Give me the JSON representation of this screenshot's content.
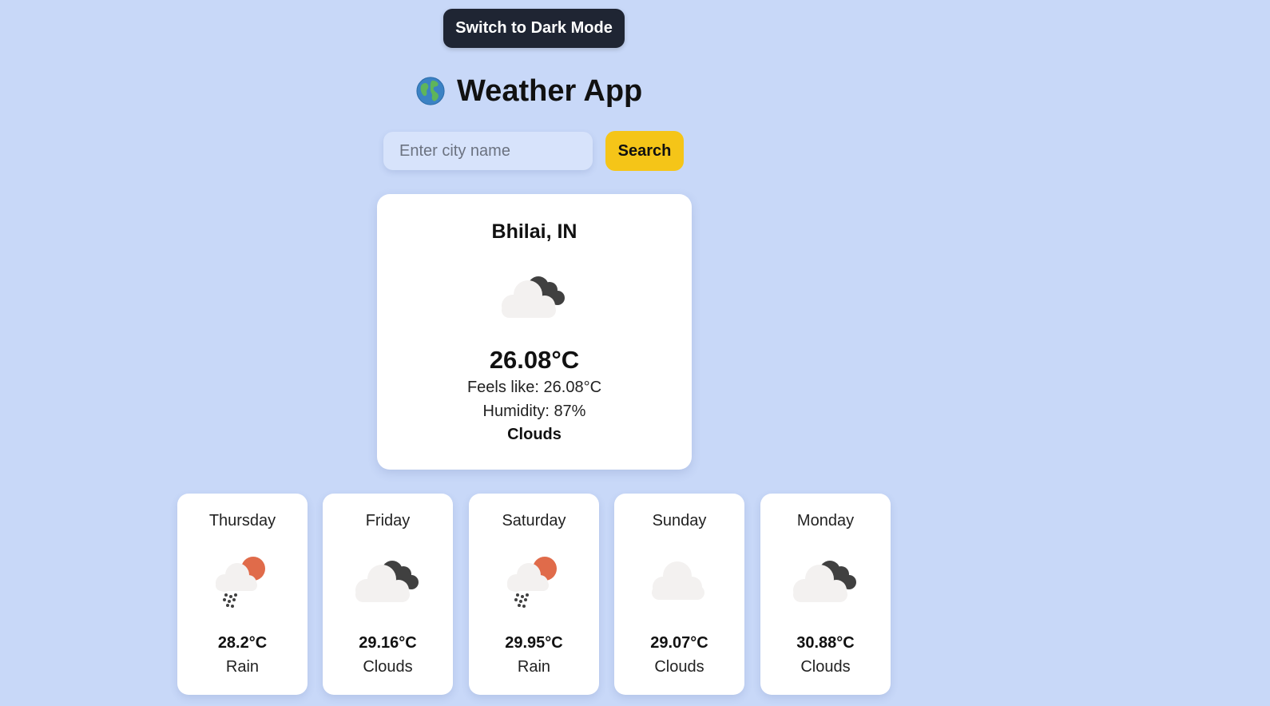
{
  "theme_toggle": {
    "label": "Switch to Dark Mode"
  },
  "header": {
    "title": "Weather App",
    "icon": "globe-icon"
  },
  "search": {
    "placeholder": "Enter city name",
    "value": "",
    "button_label": "Search"
  },
  "current": {
    "city": "Bhilai, IN",
    "icon": "broken-clouds-icon",
    "temperature": "26.08°C",
    "feels_like": "Feels like: 26.08°C",
    "humidity": "Humidity: 87%",
    "condition": "Clouds"
  },
  "forecast": [
    {
      "day": "Thursday",
      "icon": "rain-sun-icon",
      "temp": "28.2°C",
      "condition": "Rain"
    },
    {
      "day": "Friday",
      "icon": "broken-clouds-icon",
      "temp": "29.16°C",
      "condition": "Clouds"
    },
    {
      "day": "Saturday",
      "icon": "rain-sun-icon",
      "temp": "29.95°C",
      "condition": "Rain"
    },
    {
      "day": "Sunday",
      "icon": "cloud-icon",
      "temp": "29.07°C",
      "condition": "Clouds"
    },
    {
      "day": "Monday",
      "icon": "broken-clouds-icon",
      "temp": "30.88°C",
      "condition": "Clouds"
    }
  ],
  "colors": {
    "background": "#c8d8f8",
    "toggle_bg": "#1f2533",
    "search_button": "#f5c518",
    "card": "#ffffff",
    "sun": "#e06b4a",
    "dark_cloud": "#404040",
    "light_cloud": "#f3f1f0"
  }
}
